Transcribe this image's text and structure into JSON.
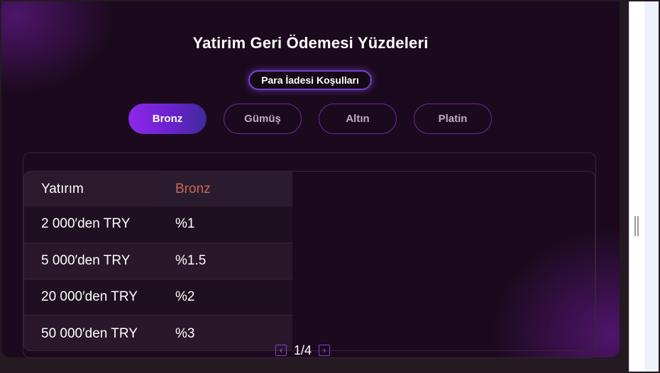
{
  "page": {
    "title": "Yatirim Geri Ödemesi Yüzdeleri",
    "conditions_label": "Para İadesi Koşulları"
  },
  "tabs": [
    {
      "label": "Bronz",
      "active": true
    },
    {
      "label": "Gümüş",
      "active": false
    },
    {
      "label": "Altın",
      "active": false
    },
    {
      "label": "Platin",
      "active": false
    }
  ],
  "table": {
    "headers": [
      "Yatırım",
      "Bronz"
    ],
    "rows": [
      [
        "2 000′den TRY",
        "%1"
      ],
      [
        "5 000′den TRY",
        "%1.5"
      ],
      [
        "20 000′den TRY",
        "%2"
      ],
      [
        "50 000′den TRY",
        "%3"
      ]
    ]
  },
  "pagination": {
    "prev_icon": "chevron-left-icon",
    "next_icon": "chevron-right-icon",
    "label": "1/4"
  },
  "colors": {
    "accent": "#8e28ea",
    "background": "#1b0a1d",
    "header_highlight": "#c9675d"
  }
}
